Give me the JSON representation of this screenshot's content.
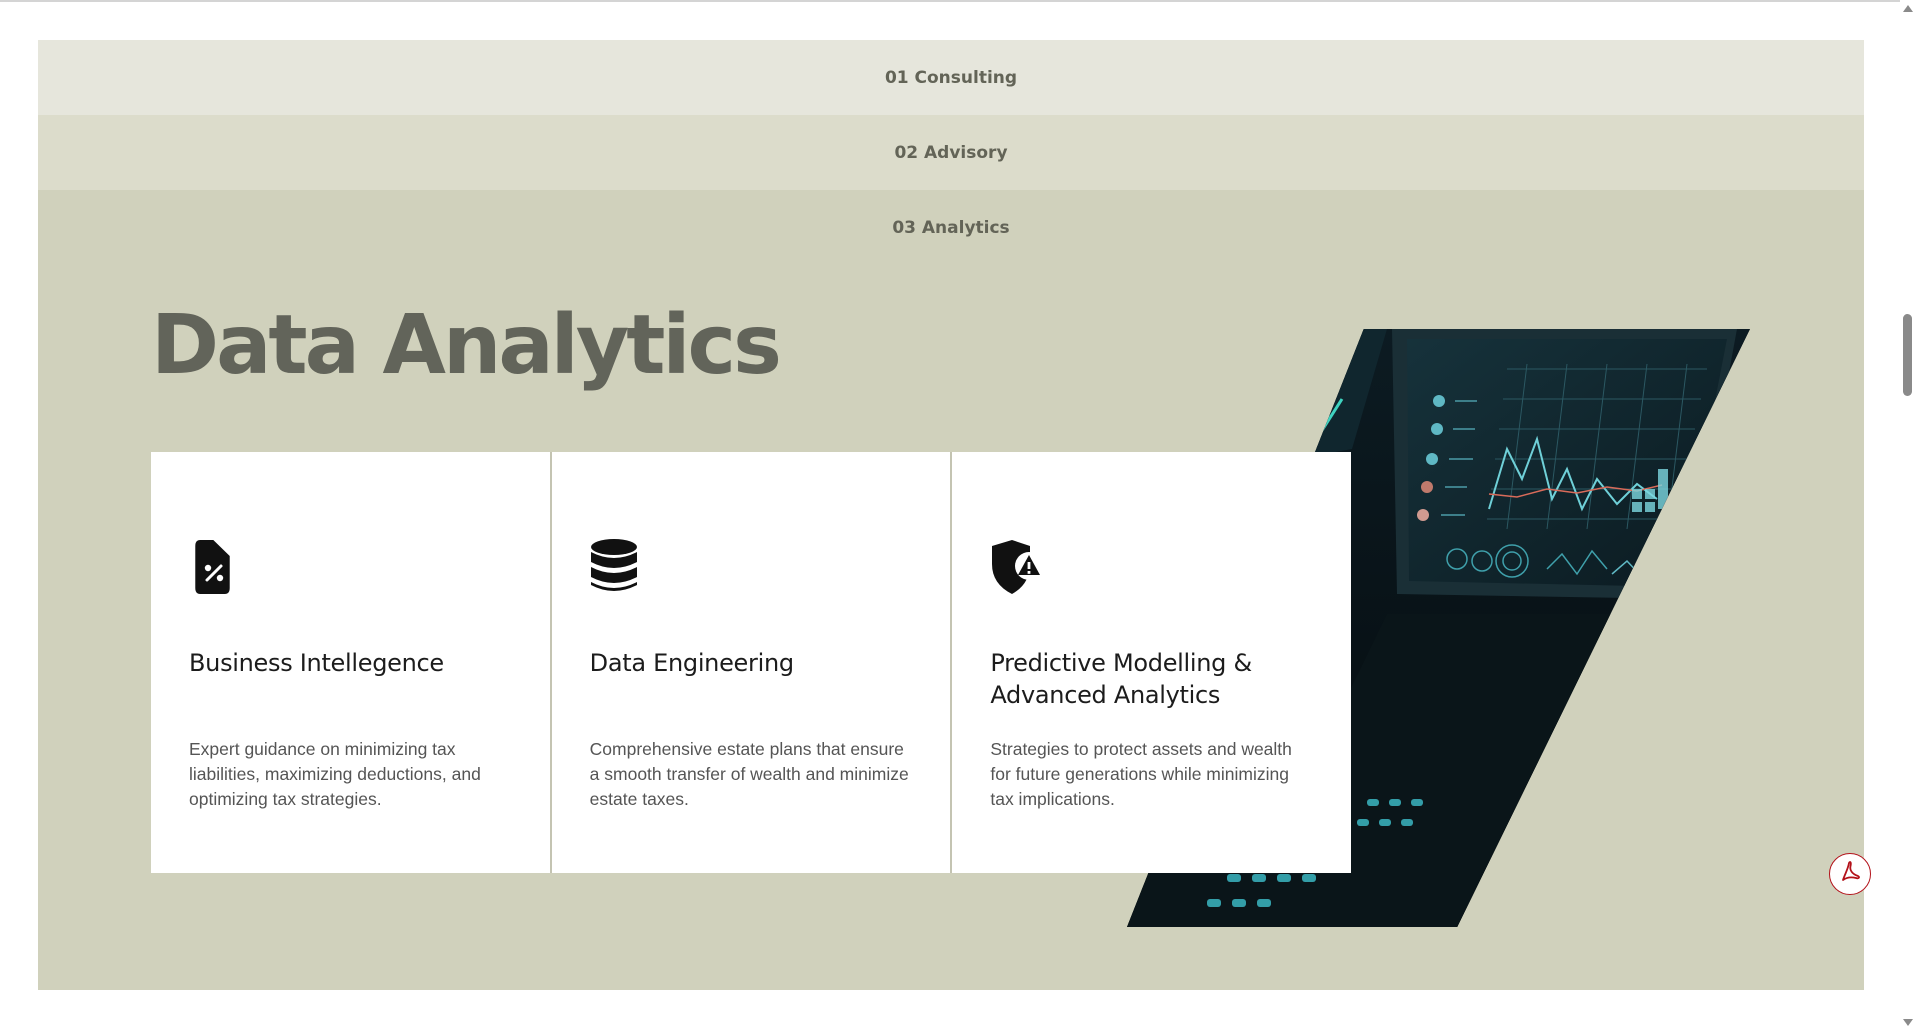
{
  "tabs": [
    {
      "label": "01 Consulting"
    },
    {
      "label": "02 Advisory"
    },
    {
      "label": "03 Analytics"
    }
  ],
  "panel": {
    "title": "Data Analytics",
    "image": "analytics-dashboard-laptop-photo",
    "cards": [
      {
        "icon": "percent-document-icon",
        "title": "Business Intellegence",
        "description": "Expert guidance on minimizing tax liabilities, maximizing deductions, and optimizing tax strategies."
      },
      {
        "icon": "database-icon",
        "title": "Data Engineering",
        "description": "Comprehensive estate plans that ensure a smooth transfer of wealth and minimize estate taxes."
      },
      {
        "icon": "shield-warning-icon",
        "title": "Predictive Modelling & Advanced Analytics",
        "description": "Strategies to protect assets and wealth for future generations while minimizing tax implications."
      }
    ]
  },
  "floating_button": {
    "icon": "acrobat-pdf-icon"
  },
  "colors": {
    "tab1_bg": "#e6e6dc",
    "tab2_bg": "#dcdccb",
    "panel_bg": "#d0d1bc",
    "title_text": "#62645a",
    "pdf_red": "#b3121a"
  }
}
